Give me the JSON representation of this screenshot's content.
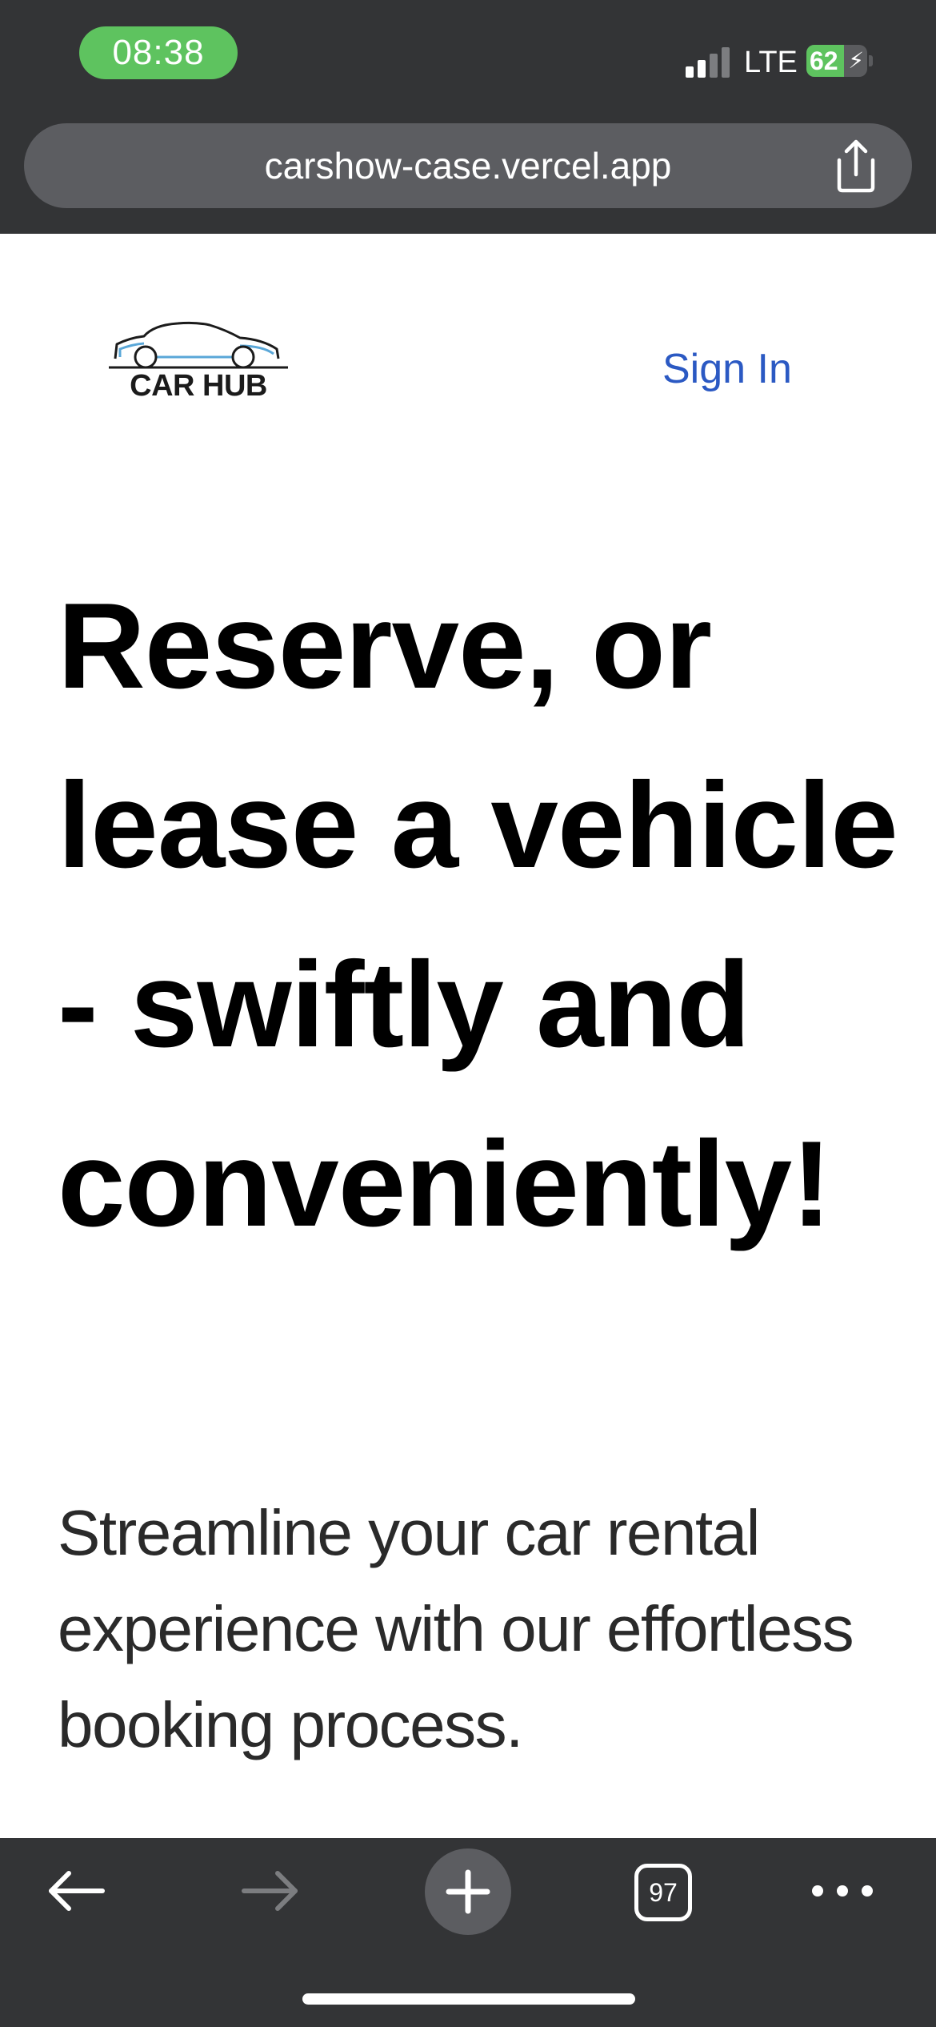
{
  "status_bar": {
    "time": "08:38",
    "network": "LTE",
    "battery_level": "62",
    "battery_fraction": 0.62,
    "signal_bars_active": 2,
    "signal_bars_total": 4
  },
  "browser": {
    "url": "carshow-case.vercel.app",
    "tab_count": "97"
  },
  "header": {
    "logo_text": "CAR HUB",
    "sign_in_label": "Sign In"
  },
  "hero": {
    "title": "Reserve, or lease a vehicle - swiftly and conveniently!",
    "subtitle": "Streamline your car rental experience with our effortless booking process."
  },
  "colors": {
    "chrome_bg": "#333436",
    "url_bar_bg": "#5c5d61",
    "time_pill": "#5ec35f",
    "link_blue": "#2b59c3",
    "logo_accent": "#5aa7d8"
  },
  "icons": {
    "share": "share-icon",
    "back": "arrow-left-icon",
    "forward": "arrow-right-icon",
    "new_tab": "plus-icon",
    "tabs": "tabs-count-icon",
    "more": "more-dots-icon"
  }
}
